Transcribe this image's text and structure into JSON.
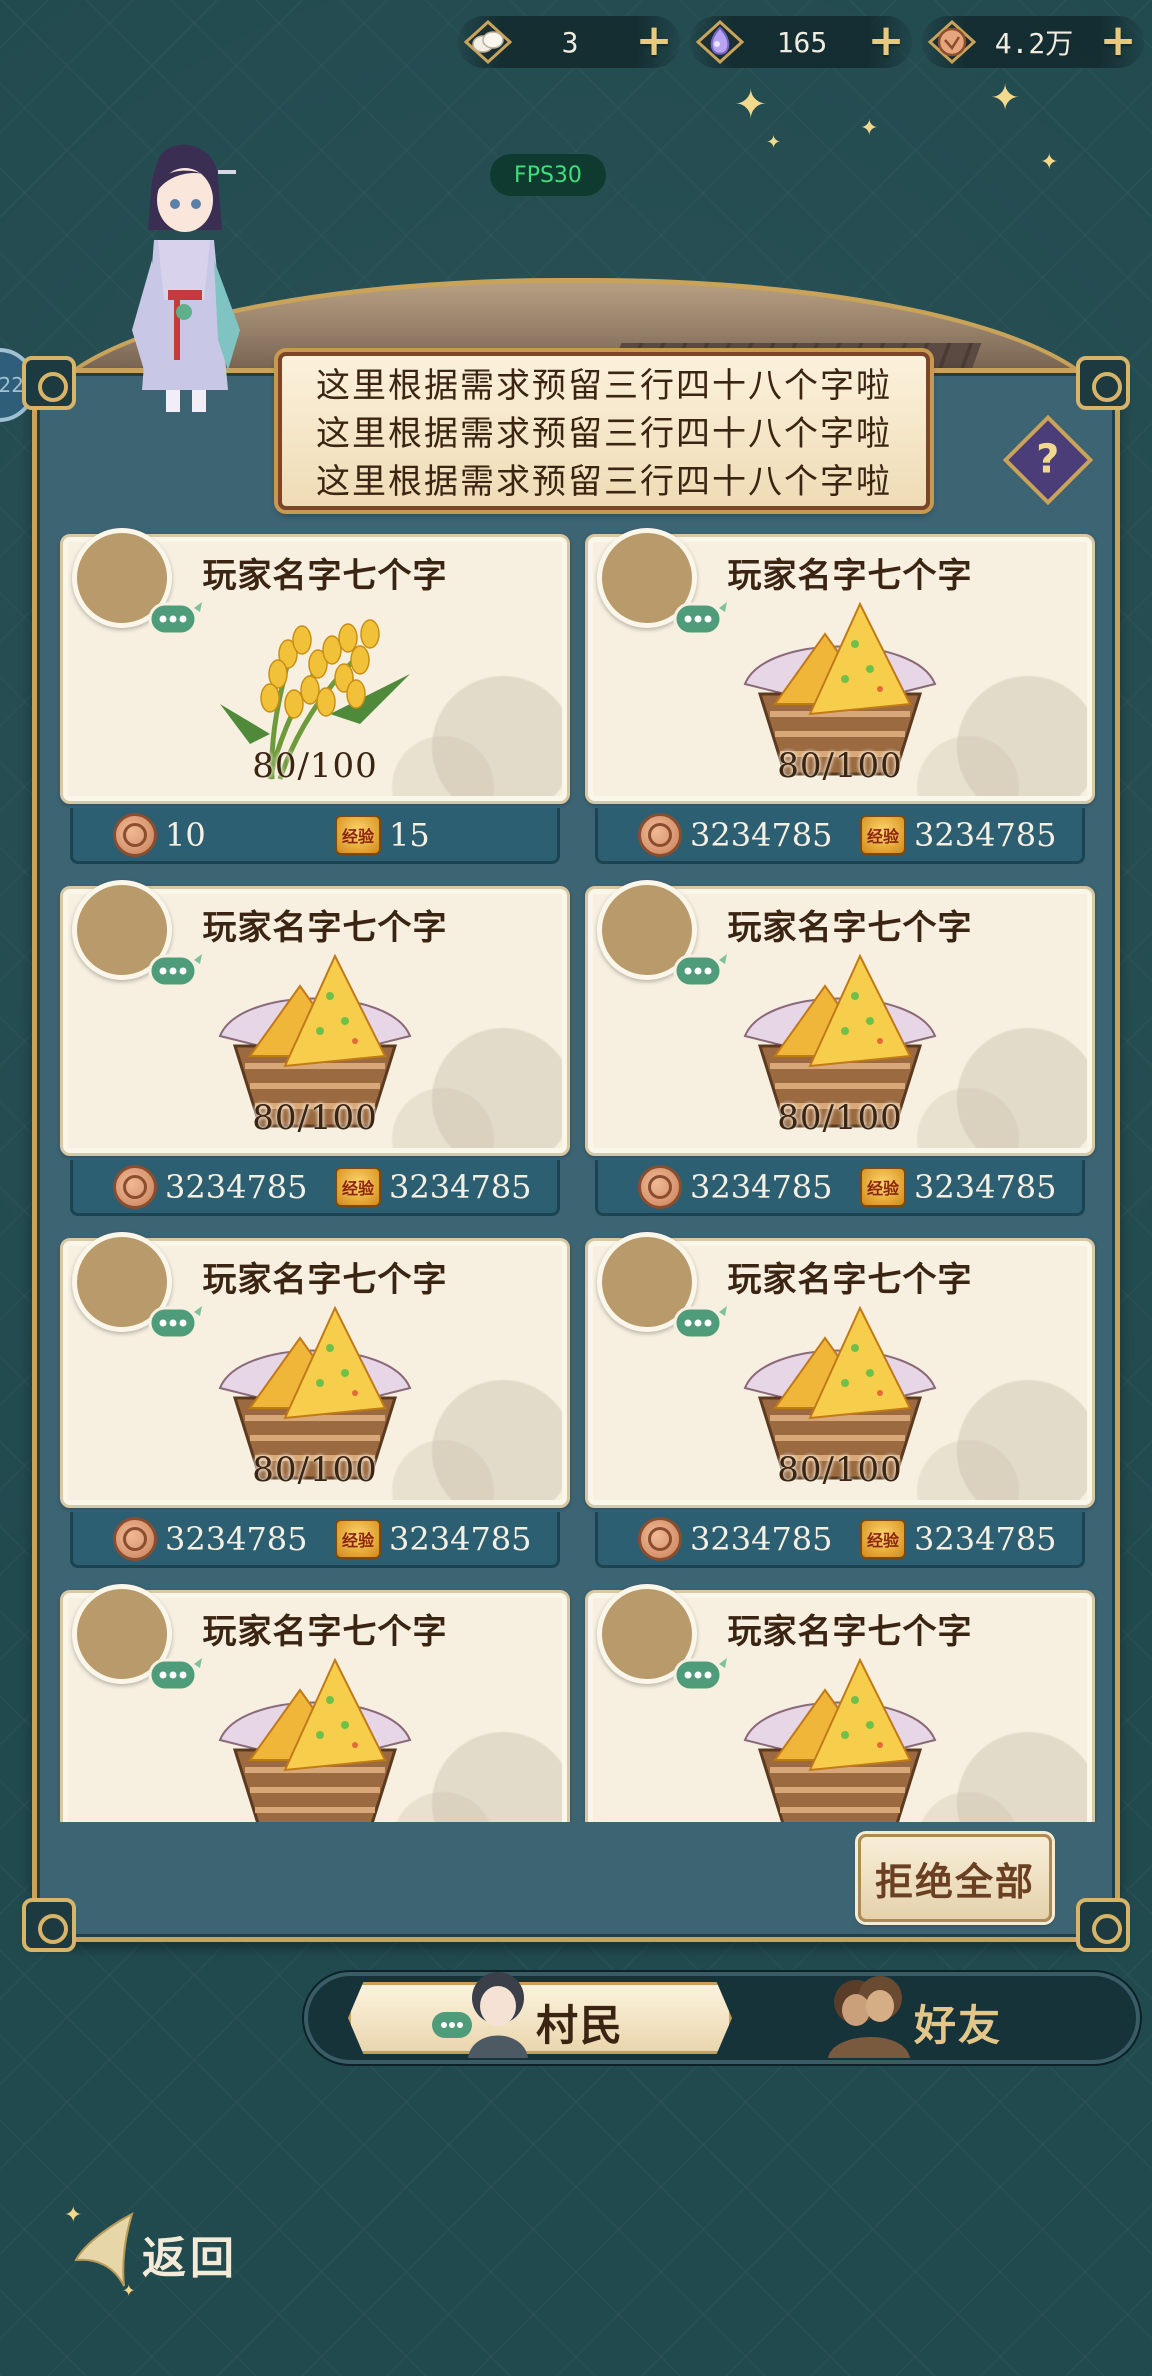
{
  "currencies": [
    {
      "icon": "dumpling-icon",
      "value": "3"
    },
    {
      "icon": "crystal-icon",
      "value": "165"
    },
    {
      "icon": "copper-coin-icon",
      "value": "4.2万"
    }
  ],
  "fps": "FPS30",
  "side_tab": "22",
  "banner": {
    "lines": [
      "这里根据需求预留三行四十八个字啦",
      "这里根据需求预留三行四十八个字啦",
      "这里根据需求预留三行四十八个字啦"
    ]
  },
  "help_label": "?",
  "cards": [
    {
      "name": "玩家名字七个字",
      "item": "rice",
      "progress": "80/100",
      "coin": "10",
      "exp": "15"
    },
    {
      "name": "玩家名字七个字",
      "item": "pancake",
      "progress": "80/100",
      "coin": "3234785",
      "exp": "3234785"
    },
    {
      "name": "玩家名字七个字",
      "item": "pancake",
      "progress": "80/100",
      "coin": "3234785",
      "exp": "3234785"
    },
    {
      "name": "玩家名字七个字",
      "item": "pancake",
      "progress": "80/100",
      "coin": "3234785",
      "exp": "3234785"
    },
    {
      "name": "玩家名字七个字",
      "item": "pancake",
      "progress": "80/100",
      "coin": "3234785",
      "exp": "3234785"
    },
    {
      "name": "玩家名字七个字",
      "item": "pancake",
      "progress": "80/100",
      "coin": "3234785",
      "exp": "3234785"
    },
    {
      "name": "玩家名字七个字",
      "item": "pancake",
      "progress": "",
      "coin": "",
      "exp": ""
    },
    {
      "name": "玩家名字七个字",
      "item": "pancake",
      "progress": "",
      "coin": "",
      "exp": ""
    }
  ],
  "exp_badge": "经验",
  "reject_all": "拒绝全部",
  "tabs": {
    "villagers": "村民",
    "friends": "好友"
  },
  "back": "返回",
  "colors": {
    "background": "#214a4f",
    "panel": "#3d6473",
    "gold_border": "#c9a35a",
    "card": "#f7f0e0",
    "reward_bar": "#2d5f73",
    "fps_text": "#3fe07a"
  }
}
